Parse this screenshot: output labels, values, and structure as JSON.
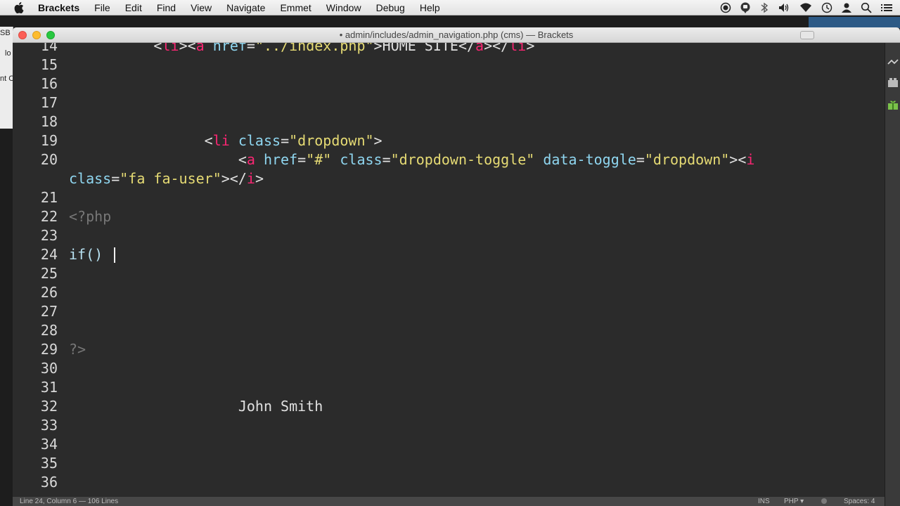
{
  "menubar": {
    "app": "Brackets",
    "items": [
      "File",
      "Edit",
      "Find",
      "View",
      "Navigate",
      "Emmet",
      "Window",
      "Debug",
      "Help"
    ],
    "status_icons": [
      "record-icon",
      "chat-icon",
      "bluetooth-icon",
      "volume-icon",
      "wifi-icon",
      "clock-icon",
      "user-icon",
      "search-icon",
      "list-icon"
    ]
  },
  "background_windows": [
    "SB",
    "lo",
    "nt C"
  ],
  "window": {
    "title": "• admin/includes/admin_navigation.php (cms) — Brackets"
  },
  "editor": {
    "lines": [
      {
        "num": "14",
        "segments": [
          [
            "plain",
            "          "
          ],
          [
            "tag-br",
            "<"
          ],
          [
            "tag",
            "li"
          ],
          [
            "tag-br",
            "><"
          ],
          [
            "tag",
            "a"
          ],
          [
            "plain",
            " "
          ],
          [
            "attr",
            "href"
          ],
          [
            "plain",
            "="
          ],
          [
            "str",
            "\"../index.php\""
          ],
          [
            "plain",
            ">HOME SITE</"
          ],
          [
            "tag",
            "a"
          ],
          [
            "plain",
            "></"
          ],
          [
            "tag",
            "li"
          ],
          [
            "plain",
            ">"
          ]
        ]
      },
      {
        "num": "15",
        "segments": []
      },
      {
        "num": "16",
        "segments": []
      },
      {
        "num": "17",
        "segments": []
      },
      {
        "num": "18",
        "segments": []
      },
      {
        "num": "19",
        "segments": [
          [
            "plain",
            "                <"
          ],
          [
            "tag",
            "li"
          ],
          [
            "plain",
            " "
          ],
          [
            "attr",
            "class"
          ],
          [
            "plain",
            "="
          ],
          [
            "str",
            "\"dropdown\""
          ],
          [
            "plain",
            ">"
          ]
        ]
      },
      {
        "num": "20",
        "segments": [
          [
            "plain",
            "                    <"
          ],
          [
            "tag",
            "a"
          ],
          [
            "plain",
            " "
          ],
          [
            "attr",
            "href"
          ],
          [
            "plain",
            "="
          ],
          [
            "str",
            "\"#\""
          ],
          [
            "plain",
            " "
          ],
          [
            "attr",
            "class"
          ],
          [
            "plain",
            "="
          ],
          [
            "str",
            "\"dropdown-toggle\""
          ],
          [
            "plain",
            " "
          ],
          [
            "attr",
            "data-toggle"
          ],
          [
            "plain",
            "="
          ],
          [
            "str",
            "\"dropdown\""
          ],
          [
            "plain",
            "><"
          ],
          [
            "tag",
            "i"
          ]
        ]
      },
      {
        "num": "",
        "segments": [
          [
            "attr",
            "class"
          ],
          [
            "plain",
            "="
          ],
          [
            "str",
            "\"fa fa-user\""
          ],
          [
            "plain",
            "></"
          ],
          [
            "tag",
            "i"
          ],
          [
            "plain",
            ">"
          ]
        ]
      },
      {
        "num": "21",
        "segments": []
      },
      {
        "num": "22",
        "segments": [
          [
            "meta",
            "<?php"
          ]
        ]
      },
      {
        "num": "23",
        "segments": []
      },
      {
        "num": "24",
        "segments": [
          [
            "kw",
            "if() "
          ]
        ]
      },
      {
        "num": "25",
        "segments": []
      },
      {
        "num": "26",
        "segments": []
      },
      {
        "num": "27",
        "segments": []
      },
      {
        "num": "28",
        "segments": []
      },
      {
        "num": "29",
        "segments": [
          [
            "meta",
            "?>"
          ]
        ]
      },
      {
        "num": "30",
        "segments": []
      },
      {
        "num": "31",
        "segments": []
      },
      {
        "num": "32",
        "segments": [
          [
            "plain",
            "                    John Smith"
          ]
        ]
      },
      {
        "num": "33",
        "segments": []
      },
      {
        "num": "34",
        "segments": []
      },
      {
        "num": "35",
        "segments": []
      },
      {
        "num": "36",
        "segments": []
      }
    ]
  },
  "statusbar": {
    "position": "Line 24, Column 6 — 106 Lines",
    "mode": "INS",
    "language": "PHP ▾",
    "spaces": "Spaces: 4"
  }
}
